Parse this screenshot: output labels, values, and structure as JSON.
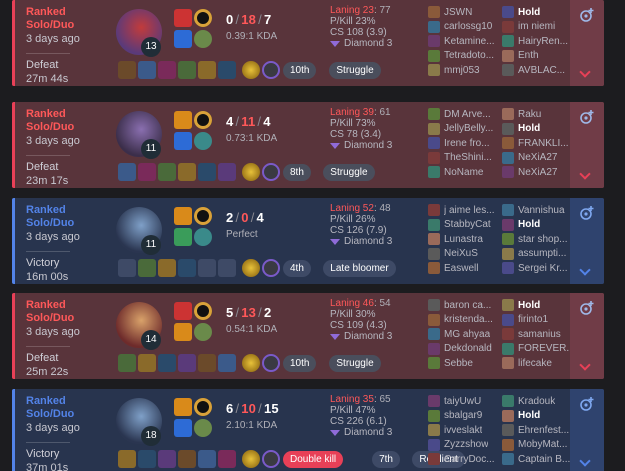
{
  "matches": [
    {
      "result_class": "defeat",
      "queue": "Ranked Solo/Duo",
      "ago": "3 days ago",
      "result": "Defeat",
      "duration": "27m 44s",
      "level": "13",
      "kills": "0",
      "deaths": "18",
      "assists": "7",
      "ratio": "0.39:1 KDA",
      "badges": [
        {
          "text": "10th",
          "style": "grey"
        },
        {
          "text": "Struggle",
          "style": "grey"
        }
      ],
      "laning_label": "Laning 23",
      "laning_rest": ": 77",
      "pkill": "P/Kill 23%",
      "cs": "CS 108 (3.9)",
      "tier": "Diamond 3",
      "team1": [
        "JSWN",
        "carlossg10",
        "Ketamine...",
        "Tetradoto...",
        "mmj053"
      ],
      "team2": [
        "Hold",
        "im niemi",
        "HairyRen...",
        "Enth",
        "AVBLAC..."
      ],
      "me_team": 2,
      "me_index": 0
    },
    {
      "result_class": "defeat",
      "queue": "Ranked Solo/Duo",
      "ago": "3 days ago",
      "result": "Defeat",
      "duration": "23m 17s",
      "level": "11",
      "kills": "4",
      "deaths": "11",
      "assists": "4",
      "ratio": "0.73:1 KDA",
      "badges": [
        {
          "text": "8th",
          "style": "grey"
        },
        {
          "text": "Struggle",
          "style": "grey"
        }
      ],
      "laning_label": "Laning 39",
      "laning_rest": ": 61",
      "pkill": "P/Kill 73%",
      "cs": "CS 78 (3.4)",
      "tier": "Diamond 3",
      "team1": [
        "DM Arve...",
        "JellyBelly...",
        "Irene fro...",
        "TheShini...",
        "NoName"
      ],
      "team2": [
        "Raku",
        "Hold",
        "FRANKLI...",
        "NeXiA27",
        "NeXiA27"
      ],
      "me_team": 2,
      "me_index": 1
    },
    {
      "result_class": "victory",
      "queue": "Ranked Solo/Duo",
      "ago": "3 days ago",
      "result": "Victory",
      "duration": "16m 00s",
      "level": "11",
      "kills": "2",
      "deaths": "0",
      "assists": "4",
      "ratio": "Perfect",
      "badges": [
        {
          "text": "4th",
          "style": "grey"
        },
        {
          "text": "Late bloomer",
          "style": "grey"
        }
      ],
      "laning_label": "Laning 52",
      "laning_rest": ": 48",
      "pkill": "P/Kill 26%",
      "cs": "CS 126 (7.9)",
      "tier": "Diamond 3",
      "team1": [
        "j aime les...",
        "StabbyCat",
        "Lunastra",
        "NeiXuS",
        "Easwell"
      ],
      "team2": [
        "Vannishua",
        "Hold",
        "star shop...",
        "assumpti...",
        "Sergei Kr..."
      ],
      "me_team": 2,
      "me_index": 1
    },
    {
      "result_class": "defeat",
      "queue": "Ranked Solo/Duo",
      "ago": "3 days ago",
      "result": "Defeat",
      "duration": "25m 22s",
      "level": "14",
      "kills": "5",
      "deaths": "13",
      "assists": "2",
      "ratio": "0.54:1 KDA",
      "badges": [
        {
          "text": "10th",
          "style": "grey"
        },
        {
          "text": "Struggle",
          "style": "grey"
        }
      ],
      "laning_label": "Laning 46",
      "laning_rest": ": 54",
      "pkill": "P/Kill 30%",
      "cs": "CS 109 (4.3)",
      "tier": "Diamond 3",
      "team1": [
        "baron ca...",
        "kristenda...",
        "MG ahyaa",
        "Dekdonald",
        "Sebbe"
      ],
      "team2": [
        "Hold",
        "firinto1",
        "samanius",
        "FOREVER...",
        "lifecake"
      ],
      "me_team": 2,
      "me_index": 0
    },
    {
      "result_class": "victory",
      "queue": "Ranked Solo/Duo",
      "ago": "3 days ago",
      "result": "Victory",
      "duration": "37m 01s",
      "level": "18",
      "kills": "6",
      "deaths": "10",
      "assists": "15",
      "ratio": "2.10:1 KDA",
      "badges": [
        {
          "text": "Double kill",
          "style": "red"
        },
        {
          "text": "7th",
          "style": "grey"
        },
        {
          "text": "Resilient",
          "style": "grey"
        }
      ],
      "laning_label": "Laning 35",
      "laning_rest": ": 65",
      "pkill": "P/Kill 47%",
      "cs": "CS 226 (6.1)",
      "tier": "Diamond 3",
      "team1": [
        "taiyUwU",
        "sbalgar9",
        "ivveslakt",
        "Zyzzshow",
        "CarryDoc..."
      ],
      "team2": [
        "Kradouk",
        "Hold",
        "Ehrenfest...",
        "MobyMat...",
        "Captain B..."
      ],
      "me_team": 2,
      "me_index": 1
    }
  ],
  "colors": {
    "defeat_bg": "#59343b",
    "victory_bg": "#28344e",
    "defeat_accent": "#e84057",
    "victory_accent": "#5383e8"
  },
  "icons": {
    "side_button": "add-to-compare-icon",
    "expand": "chevron-down-icon"
  }
}
